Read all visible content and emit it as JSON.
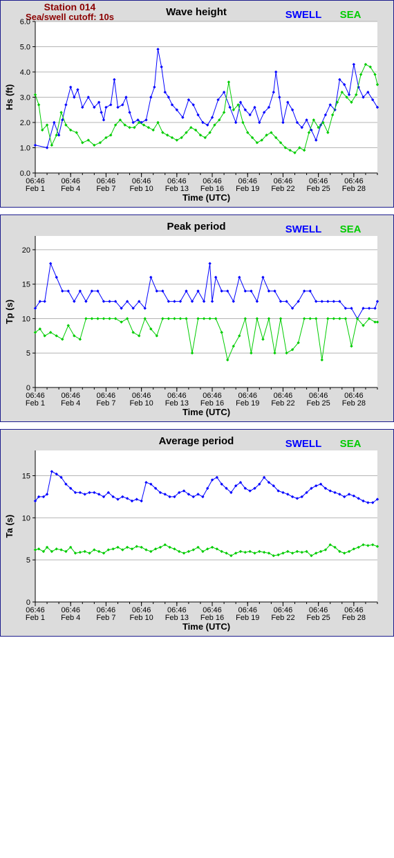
{
  "station": {
    "title": "Station 014",
    "subtitle": "Sea/swell cutoff: 10s"
  },
  "legend": {
    "swell_label": "SWELL",
    "sea_label": "SEA",
    "swell_color": "#0000ff",
    "sea_color": "#00cc00"
  },
  "x_axis": {
    "label": "Time (UTC)",
    "tick_time": "06:46",
    "tick_dates": [
      "Feb 1",
      "Feb 4",
      "Feb 7",
      "Feb 10",
      "Feb 13",
      "Feb 16",
      "Feb 19",
      "Feb 22",
      "Feb 25",
      "Feb 28"
    ],
    "range_days": [
      1,
      30
    ]
  },
  "chart_data": [
    {
      "type": "scatter",
      "title": "Wave height",
      "xlabel": "Time (UTC)",
      "ylabel": "Hs (ft)",
      "ylim": [
        0,
        6
      ],
      "yticks": [
        "0.0",
        "1.0",
        "2.0",
        "3.0",
        "4.0",
        "5.0",
        "6.0"
      ],
      "ytick_values": [
        0,
        1,
        2,
        3,
        4,
        5,
        6
      ],
      "grid": true,
      "series": [
        {
          "name": "SWELL",
          "color": "#0000ff",
          "x": [
            1.0,
            2.0,
            2.6,
            3.0,
            3.3,
            3.6,
            4.0,
            4.3,
            4.6,
            5.0,
            5.5,
            6.0,
            6.4,
            6.6,
            6.8,
            7.0,
            7.4,
            7.7,
            8.0,
            8.4,
            8.7,
            9.0,
            9.3,
            9.7,
            10.0,
            10.4,
            10.8,
            11.1,
            11.4,
            11.7,
            12.0,
            12.3,
            12.6,
            13.0,
            13.5,
            14.0,
            14.4,
            14.8,
            15.2,
            15.6,
            16.0,
            16.5,
            17.0,
            17.5,
            18.0,
            18.4,
            18.8,
            19.2,
            19.6,
            20.0,
            20.4,
            20.8,
            21.2,
            21.4,
            21.7,
            22.0,
            22.4,
            22.8,
            23.2,
            23.6,
            24.0,
            24.4,
            24.8,
            25.2,
            25.6,
            26.0,
            26.4,
            26.8,
            27.2,
            27.6,
            28.0,
            28.4,
            28.8,
            29.2,
            29.6,
            30.0
          ],
          "values": [
            1.1,
            1.0,
            2.0,
            1.5,
            2.1,
            2.7,
            3.4,
            3.0,
            3.3,
            2.6,
            3.0,
            2.6,
            2.8,
            2.4,
            2.1,
            2.6,
            2.7,
            3.7,
            2.6,
            2.7,
            3.0,
            2.4,
            2.0,
            2.1,
            2.0,
            2.1,
            3.0,
            3.4,
            4.9,
            4.2,
            3.2,
            3.0,
            2.7,
            2.5,
            2.2,
            2.9,
            2.7,
            2.3,
            2.0,
            1.9,
            2.2,
            2.9,
            3.2,
            2.6,
            2.0,
            2.8,
            2.5,
            2.3,
            2.6,
            2.0,
            2.4,
            2.6,
            3.2,
            4.0,
            3.0,
            2.0,
            2.8,
            2.5,
            2.0,
            1.8,
            2.1,
            1.7,
            1.3,
            1.9,
            2.3,
            2.7,
            2.5,
            3.7,
            3.5,
            3.1,
            4.3,
            3.4,
            3.0,
            3.2,
            2.9,
            2.6
          ]
        },
        {
          "name": "SEA",
          "color": "#00cc00",
          "x": [
            1.0,
            1.3,
            1.6,
            2.0,
            2.4,
            2.8,
            3.2,
            3.6,
            4.0,
            4.5,
            5.0,
            5.5,
            6.0,
            6.5,
            7.0,
            7.4,
            7.8,
            8.2,
            8.6,
            9.0,
            9.4,
            9.8,
            10.2,
            10.6,
            11.0,
            11.4,
            11.8,
            12.2,
            12.6,
            13.0,
            13.4,
            13.8,
            14.2,
            14.6,
            15.0,
            15.4,
            15.8,
            16.2,
            16.6,
            17.0,
            17.4,
            17.8,
            18.2,
            18.6,
            19.0,
            19.4,
            19.8,
            20.2,
            20.6,
            21.0,
            21.4,
            21.8,
            22.2,
            22.6,
            23.0,
            23.4,
            23.8,
            24.2,
            24.6,
            25.0,
            25.4,
            25.8,
            26.2,
            26.6,
            27.0,
            27.4,
            27.8,
            28.2,
            28.6,
            29.0,
            29.4,
            29.8,
            30.0
          ],
          "values": [
            3.1,
            2.7,
            1.7,
            1.9,
            1.1,
            1.5,
            2.4,
            1.9,
            1.7,
            1.6,
            1.2,
            1.3,
            1.1,
            1.2,
            1.4,
            1.5,
            1.9,
            2.1,
            1.9,
            1.8,
            1.8,
            2.0,
            1.9,
            1.8,
            1.7,
            2.0,
            1.6,
            1.5,
            1.4,
            1.3,
            1.4,
            1.6,
            1.8,
            1.7,
            1.5,
            1.4,
            1.6,
            1.9,
            2.1,
            2.4,
            3.6,
            2.5,
            2.7,
            2.0,
            1.6,
            1.4,
            1.2,
            1.3,
            1.5,
            1.6,
            1.4,
            1.2,
            1.0,
            0.9,
            0.8,
            1.0,
            0.9,
            1.6,
            2.1,
            1.8,
            2.0,
            1.6,
            2.3,
            2.8,
            3.2,
            3.0,
            2.8,
            3.1,
            3.9,
            4.3,
            4.2,
            3.9,
            3.5
          ]
        }
      ]
    },
    {
      "type": "scatter",
      "title": "Peak period",
      "xlabel": "Time (UTC)",
      "ylabel": "Tp (s)",
      "ylim": [
        0,
        22
      ],
      "yticks": [
        "0",
        "5",
        "10",
        "15",
        "20"
      ],
      "ytick_values": [
        0,
        5,
        10,
        15,
        20
      ],
      "grid": true,
      "series": [
        {
          "name": "SWELL",
          "color": "#0000ff",
          "x": [
            1.0,
            1.4,
            1.8,
            2.3,
            2.8,
            3.3,
            3.8,
            4.3,
            4.8,
            5.3,
            5.8,
            6.3,
            6.8,
            7.3,
            7.8,
            8.3,
            8.8,
            9.3,
            9.8,
            10.3,
            10.8,
            11.3,
            11.8,
            12.3,
            12.8,
            13.3,
            13.8,
            14.3,
            14.8,
            15.3,
            15.8,
            16.0,
            16.3,
            16.8,
            17.3,
            17.8,
            18.3,
            18.8,
            19.3,
            19.8,
            20.3,
            20.8,
            21.3,
            21.8,
            22.3,
            22.8,
            23.3,
            23.8,
            24.3,
            24.8,
            25.3,
            25.8,
            26.3,
            26.8,
            27.3,
            27.8,
            28.3,
            28.8,
            29.3,
            29.8,
            30.0
          ],
          "values": [
            11.5,
            12.5,
            12.5,
            18.0,
            16.0,
            14.0,
            14.0,
            12.5,
            14.0,
            12.5,
            14.0,
            14.0,
            12.5,
            12.5,
            12.5,
            11.5,
            12.5,
            11.5,
            12.5,
            11.5,
            16.0,
            14.0,
            14.0,
            12.5,
            12.5,
            12.5,
            14.0,
            12.5,
            14.0,
            12.5,
            18.0,
            12.5,
            16.0,
            14.0,
            14.0,
            12.5,
            16.0,
            14.0,
            14.0,
            12.5,
            16.0,
            14.0,
            14.0,
            12.5,
            12.5,
            11.5,
            12.5,
            14.0,
            14.0,
            12.5,
            12.5,
            12.5,
            12.5,
            12.5,
            11.5,
            11.5,
            10.0,
            11.5,
            11.5,
            11.5,
            12.5
          ]
        },
        {
          "name": "SEA",
          "color": "#00cc00",
          "x": [
            1.0,
            1.4,
            1.8,
            2.3,
            2.8,
            3.3,
            3.8,
            4.3,
            4.8,
            5.3,
            5.8,
            6.3,
            6.8,
            7.3,
            7.8,
            8.3,
            8.8,
            9.3,
            9.8,
            10.3,
            10.8,
            11.3,
            11.8,
            12.3,
            12.8,
            13.3,
            13.8,
            14.3,
            14.8,
            15.3,
            15.8,
            16.3,
            16.8,
            17.3,
            17.8,
            18.3,
            18.8,
            19.3,
            19.8,
            20.3,
            20.8,
            21.3,
            21.8,
            22.3,
            22.8,
            23.3,
            23.8,
            24.3,
            24.8,
            25.3,
            25.8,
            26.3,
            26.8,
            27.3,
            27.8,
            28.3,
            28.8,
            29.3,
            29.8,
            30.0
          ],
          "values": [
            8.0,
            8.5,
            7.5,
            8.0,
            7.5,
            7.0,
            9.0,
            7.5,
            7.0,
            10.0,
            10.0,
            10.0,
            10.0,
            10.0,
            10.0,
            9.5,
            10.0,
            8.0,
            7.5,
            10.0,
            8.5,
            7.5,
            10.0,
            10.0,
            10.0,
            10.0,
            10.0,
            5.0,
            10.0,
            10.0,
            10.0,
            10.0,
            8.0,
            4.0,
            6.0,
            7.5,
            10.0,
            5.0,
            10.0,
            7.0,
            10.0,
            5.0,
            10.0,
            5.0,
            5.5,
            6.5,
            10.0,
            10.0,
            10.0,
            4.0,
            10.0,
            10.0,
            10.0,
            10.0,
            6.0,
            10.0,
            9.0,
            10.0,
            9.5,
            9.5
          ]
        }
      ]
    },
    {
      "type": "scatter",
      "title": "Average period",
      "xlabel": "Time (UTC)",
      "ylabel": "Ta (s)",
      "ylim": [
        0,
        18
      ],
      "yticks": [
        "0",
        "5",
        "10",
        "15"
      ],
      "ytick_values": [
        0,
        5,
        10,
        15
      ],
      "grid": true,
      "series": [
        {
          "name": "SWELL",
          "color": "#0000ff",
          "x": [
            1.0,
            1.3,
            1.7,
            2.0,
            2.4,
            2.8,
            3.2,
            3.6,
            4.0,
            4.4,
            4.8,
            5.2,
            5.6,
            6.0,
            6.4,
            6.8,
            7.2,
            7.6,
            8.0,
            8.4,
            8.8,
            9.2,
            9.6,
            10.0,
            10.4,
            10.8,
            11.2,
            11.6,
            12.0,
            12.4,
            12.8,
            13.2,
            13.6,
            14.0,
            14.4,
            14.8,
            15.2,
            15.6,
            16.0,
            16.4,
            16.8,
            17.2,
            17.6,
            18.0,
            18.4,
            18.8,
            19.2,
            19.6,
            20.0,
            20.4,
            20.8,
            21.2,
            21.6,
            22.0,
            22.4,
            22.8,
            23.2,
            23.6,
            24.0,
            24.4,
            24.8,
            25.2,
            25.6,
            26.0,
            26.4,
            26.8,
            27.2,
            27.6,
            28.0,
            28.4,
            28.8,
            29.2,
            29.6,
            30.0
          ],
          "values": [
            12.0,
            12.5,
            12.5,
            12.8,
            15.5,
            15.2,
            14.8,
            14.0,
            13.5,
            13.0,
            13.0,
            12.8,
            13.0,
            13.0,
            12.8,
            12.5,
            13.0,
            12.5,
            12.2,
            12.5,
            12.3,
            12.0,
            12.2,
            12.0,
            14.2,
            14.0,
            13.5,
            13.0,
            12.8,
            12.5,
            12.5,
            13.0,
            13.2,
            12.8,
            12.5,
            12.8,
            12.5,
            13.5,
            14.5,
            14.8,
            14.0,
            13.5,
            13.0,
            13.8,
            14.2,
            13.5,
            13.2,
            13.5,
            14.0,
            14.8,
            14.2,
            13.8,
            13.2,
            13.0,
            12.8,
            12.5,
            12.3,
            12.5,
            13.0,
            13.5,
            13.8,
            14.0,
            13.5,
            13.2,
            13.0,
            12.8,
            12.5,
            12.8,
            12.6,
            12.3,
            12.0,
            11.8,
            11.8,
            12.2
          ]
        },
        {
          "name": "SEA",
          "color": "#00cc00",
          "x": [
            1.0,
            1.3,
            1.7,
            2.0,
            2.4,
            2.8,
            3.2,
            3.6,
            4.0,
            4.4,
            4.8,
            5.2,
            5.6,
            6.0,
            6.4,
            6.8,
            7.2,
            7.6,
            8.0,
            8.4,
            8.8,
            9.2,
            9.6,
            10.0,
            10.4,
            10.8,
            11.2,
            11.6,
            12.0,
            12.4,
            12.8,
            13.2,
            13.6,
            14.0,
            14.4,
            14.8,
            15.2,
            15.6,
            16.0,
            16.4,
            16.8,
            17.2,
            17.6,
            18.0,
            18.4,
            18.8,
            19.2,
            19.6,
            20.0,
            20.4,
            20.8,
            21.2,
            21.6,
            22.0,
            22.4,
            22.8,
            23.2,
            23.6,
            24.0,
            24.4,
            24.8,
            25.2,
            25.6,
            26.0,
            26.4,
            26.8,
            27.2,
            27.6,
            28.0,
            28.4,
            28.8,
            29.2,
            29.6,
            30.0
          ],
          "values": [
            6.2,
            6.3,
            6.0,
            6.5,
            6.0,
            6.3,
            6.2,
            6.0,
            6.5,
            5.8,
            5.9,
            6.0,
            5.8,
            6.2,
            6.0,
            5.8,
            6.2,
            6.3,
            6.5,
            6.2,
            6.5,
            6.3,
            6.6,
            6.5,
            6.2,
            6.0,
            6.3,
            6.5,
            6.8,
            6.5,
            6.3,
            6.0,
            5.8,
            6.0,
            6.2,
            6.5,
            6.0,
            6.3,
            6.5,
            6.3,
            6.0,
            5.8,
            5.5,
            5.8,
            6.0,
            5.9,
            6.0,
            5.8,
            6.0,
            5.9,
            5.8,
            5.5,
            5.6,
            5.8,
            6.0,
            5.8,
            6.0,
            5.9,
            6.0,
            5.5,
            5.8,
            6.0,
            6.2,
            6.8,
            6.5,
            6.0,
            5.8,
            6.0,
            6.3,
            6.5,
            6.8,
            6.7,
            6.8,
            6.6
          ]
        }
      ]
    }
  ]
}
